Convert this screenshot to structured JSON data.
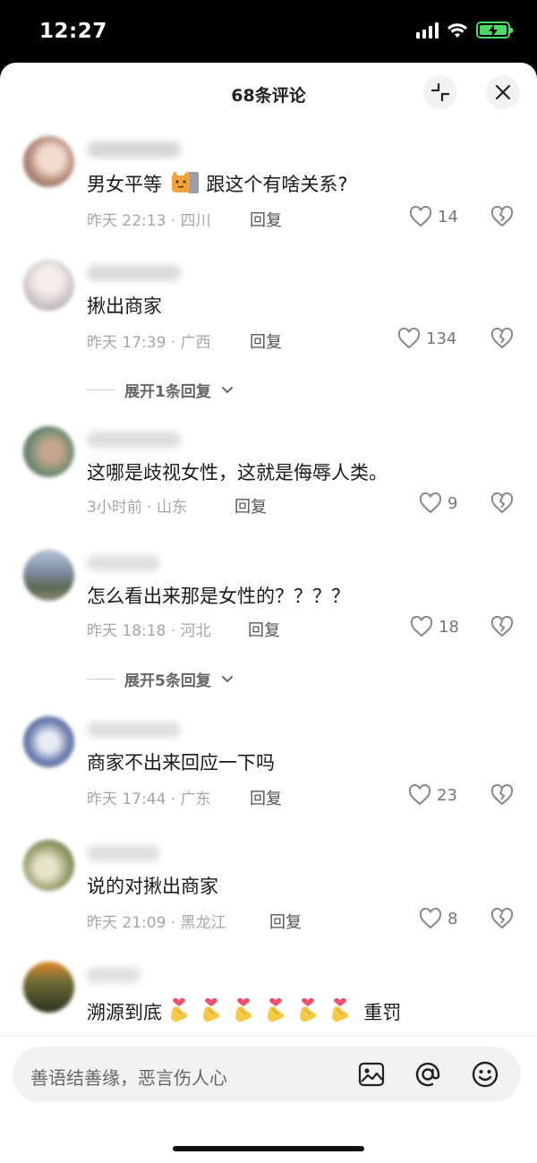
{
  "status_bar": {
    "time": "12:27"
  },
  "header": {
    "title": "68条评论"
  },
  "comments": [
    {
      "text_before": "男女平等",
      "emoji": "cat",
      "text_after": "跟这个有啥关系?",
      "meta": "昨天 22:13 · 四川",
      "reply": "回复",
      "likes": "14",
      "avatar_color": "#c9a89a"
    },
    {
      "text": "揪出商家",
      "meta": "昨天 17:39 · 广西",
      "reply": "回复",
      "likes": "134",
      "avatar_color": "#d8d2d4"
    },
    {
      "text": "这哪是歧视女性，这就是侮辱人类。",
      "meta": "3小时前 · 山东",
      "reply": "回复",
      "likes": "9",
      "avatar_color": "#8ea38b"
    },
    {
      "text": "怎么看出来那是女性的？？？？",
      "meta": "昨天 18:18 · 河北",
      "reply": "回复",
      "likes": "18",
      "avatar_color": "#8d98aa"
    },
    {
      "text": "商家不出来回应一下吗",
      "meta": "昨天 17:44 · 广东",
      "reply": "回复",
      "likes": "23",
      "avatar_color": "#9aa2b8"
    },
    {
      "text": "说的对揪出商家",
      "meta": "昨天 21:09 · 黑龙江",
      "reply": "回复",
      "likes": "8",
      "avatar_color": "#a3a57a"
    },
    {
      "text_before": "溯源到底",
      "text_after": "重罚",
      "avatar_color": "#6b6a3a"
    }
  ],
  "expand_replies": [
    {
      "label": "展开1条回复"
    },
    {
      "label": "展开5条回复"
    }
  ],
  "input": {
    "placeholder": "善语结善缘，恶言伤人心"
  },
  "icons": {
    "collapse": "collapse-icon",
    "close": "close-icon",
    "like": "heart-icon",
    "dislike": "broken-heart-icon",
    "image": "image-icon",
    "mention": "at-icon",
    "emoji": "emoji-icon"
  }
}
